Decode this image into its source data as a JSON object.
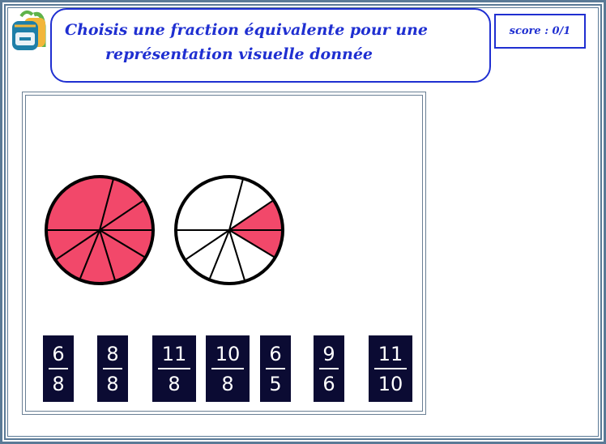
{
  "app": {
    "title_line1": "Choisis une fraction équivalente pour une",
    "title_line2": "représentation visuelle donnée",
    "score_label": "score : 0/1"
  },
  "icon": {
    "name": "backpack-icon",
    "colors": {
      "body": "#1e7fa8",
      "accent": "#f2b63a",
      "straps": "#5fb34a"
    }
  },
  "colors": {
    "accent": "#1f2fd1",
    "filled": "#f2486a",
    "empty": "#ffffff",
    "card": "#0b0b33",
    "border": "#5a7a96"
  },
  "pies": [
    {
      "parts": 8,
      "filled": 8
    },
    {
      "parts": 8,
      "filled": 2
    }
  ],
  "fractions": [
    {
      "numerator": "6",
      "denominator": "8"
    },
    {
      "numerator": "8",
      "denominator": "8"
    },
    {
      "numerator": "11",
      "denominator": "8"
    },
    {
      "numerator": "10",
      "denominator": "8"
    },
    {
      "numerator": "6",
      "denominator": "5"
    },
    {
      "numerator": "9",
      "denominator": "6"
    },
    {
      "numerator": "11",
      "denominator": "10"
    }
  ]
}
